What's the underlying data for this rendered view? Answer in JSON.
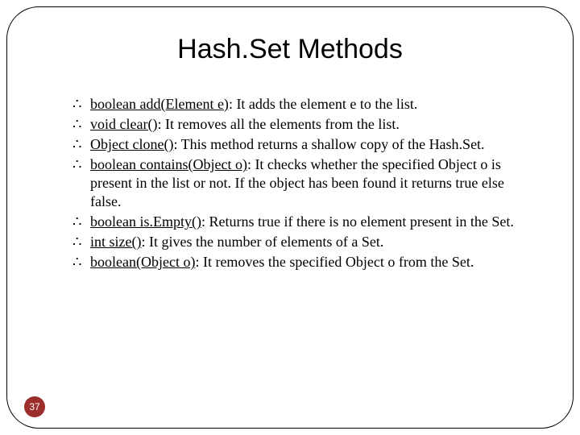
{
  "title": "Hash.Set Methods",
  "bullet_glyph": "∴",
  "items": [
    {
      "sig": "boolean add(Element  e)",
      "desc": ": It adds the element e to the list."
    },
    {
      "sig": "void clear()",
      "desc": ": It removes all the elements from the list."
    },
    {
      "sig": "Object clone()",
      "desc": ": This method returns a shallow copy of the Hash.Set."
    },
    {
      "sig": "boolean contains(Object o)",
      "desc": ": It checks whether the specified Object o is present in the list or not. If the object has been found it returns true else false."
    },
    {
      "sig": "boolean is.Empty()",
      "desc": ": Returns true if there is no element present in the Set."
    },
    {
      "sig": "int size()",
      "desc": ": It gives the number of elements of a Set."
    },
    {
      "sig": "boolean(Object o)",
      "desc": ": It removes the specified Object o from the Set."
    }
  ],
  "page_number": "37"
}
